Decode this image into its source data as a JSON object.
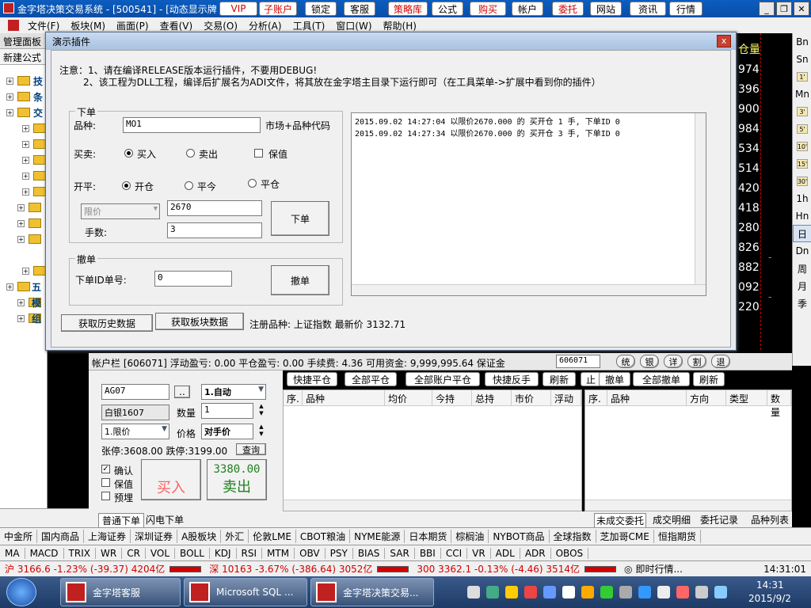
{
  "app": {
    "title": "金字塔决策交易系统 - [500541] - [动态显示牌",
    "top_buttons": [
      "VIP",
      "子账户",
      "锁定",
      "客服",
      "策略库",
      "公式",
      "购买",
      "帐户",
      "委托",
      "网站",
      "资讯",
      "行情"
    ],
    "red_buttons": [
      "VIP",
      "子账户",
      "策略库",
      "购买",
      "委托"
    ]
  },
  "menu": [
    "文件(F)",
    "板块(M)",
    "画面(P)",
    "查看(V)",
    "交易(O)",
    "分析(A)",
    "工具(T)",
    "窗口(W)",
    "帮助(H)"
  ],
  "left_panel": {
    "title": "管理面板",
    "sub": "新建公式",
    "items": [
      "技",
      "条",
      "交",
      "五",
      "模",
      "组"
    ]
  },
  "chart_values": {
    "header": "仓量",
    "values": [
      "974",
      "396",
      "900",
      "984",
      "534",
      "514",
      "420",
      "418",
      "280",
      "826",
      "882",
      "092",
      "220"
    ],
    "markers": [
      "-",
      "-"
    ]
  },
  "right_toolbar": [
    "Bn",
    "Sn",
    "1'",
    "Mn",
    "3'",
    "5'",
    "10'",
    "15'",
    "30'",
    "1h",
    "Hn",
    "日",
    "Dn",
    "周",
    "月",
    "季"
  ],
  "dialog": {
    "title": "演示插件",
    "close": "x",
    "note1": "注意：1、请在编译RELEASE版本运行插件，不要用DEBUG!",
    "note2": "2、该工程为DLL工程，编译后扩展名为ADI文件，将其放在金字塔主目录下运行即可（在工具菜单->扩展中看到你的插件）",
    "order_group": "下单",
    "symbol_label": "品种:",
    "symbol_value": "MO1",
    "symbol_hint": "市场+品种代码",
    "side_label": "买卖:",
    "buy": "买入",
    "sell": "卖出",
    "hedge": "保值",
    "offset_label": "开平:",
    "open": "开仓",
    "close_today": "平今",
    "close_pos": "平仓",
    "price_type": "限价",
    "price_value": "2670",
    "qty_label": "手数:",
    "qty_value": "3",
    "order_button": "下单",
    "cancel_group": "撤单",
    "cancel_id_label": "下单ID单号:",
    "cancel_id_value": "0",
    "cancel_button": "撤单",
    "log": [
      "2015.09.02 14:27:04 以限价2670.000 的 买开仓 1 手, 下单ID 0",
      "2015.09.02 14:27:34 以限价2670.000 的 买开仓 3 手, 下单ID 0"
    ],
    "hist_button": "获取历史数据",
    "block_button": "获取板块数据",
    "reg_text": "注册品种: 上证指数 最新价 3132.71"
  },
  "account_bar": {
    "text": "帐户栏 [606071] 浮动盈亏: 0.00   平仓盈亏: 0.00   手续费: 4.36   可用资金: 9,999,995.64   保证金",
    "account": "606071",
    "right_btns": [
      "统",
      "银",
      "详",
      "割",
      "退"
    ]
  },
  "order_panel": {
    "code": "AG07",
    "dots": "..",
    "mode": "1.自动",
    "name": "白银1607",
    "qty_label": "数量",
    "qty": "1",
    "price_type": "1.限价",
    "price_label": "价格",
    "price": "对手价",
    "limits": "张停:3608.00 跌停:3199.00",
    "query": "查询",
    "confirm": "确认",
    "hedge": "保值",
    "preset": "预埋",
    "buy": "买入",
    "sell_price": "3380.00",
    "sell": "卖出"
  },
  "action_buttons": [
    "快捷平仓",
    "全部平仓",
    "全部账户平仓",
    "快捷反手",
    "刷新",
    "止",
    "撤单",
    "全部撤单",
    "刷新"
  ],
  "mid_table": {
    "headers": [
      "序.",
      "品种",
      "均价",
      "今持",
      "总持",
      "市价",
      "浮动"
    ],
    "footer": "606071"
  },
  "right_table": {
    "headers": [
      "序.",
      "品种",
      "方向",
      "类型",
      "数量"
    ]
  },
  "bottom_tabs_left": [
    "公式",
    "普通下单",
    "闪电下单"
  ],
  "bottom_tabs_right": [
    "未成交委托",
    "成交明细",
    "委托记录",
    "品种列表"
  ],
  "markets": [
    "中金所",
    "国内商品",
    "上海证券",
    "深圳证券",
    "A股板块",
    "外汇",
    "伦敦LME",
    "CBOT粮油",
    "NYME能源",
    "日本期货",
    "棕榈油",
    "NYBOT商品",
    "全球指数",
    "芝加哥CME",
    "恒指期货"
  ],
  "indicators": [
    "MA",
    "MACD",
    "TRIX",
    "WR",
    "CR",
    "VOL",
    "BOLL",
    "KDJ",
    "RSI",
    "MTM",
    "OBV",
    "PSY",
    "BIAS",
    "SAR",
    "BBI",
    "CCI",
    "VR",
    "ADL",
    "ADR",
    "OBOS"
  ],
  "quotes": {
    "sh": "沪 3166.6 -1.23% (-39.37) 4204亿",
    "sz": "深 10163 -3.67% (-386.64) 3052亿",
    "i300": "300 3362.1 -0.13% (-4.46) 3514亿",
    "news": "即时行情...",
    "time": "14:31:01"
  },
  "taskbar": {
    "tasks": [
      "金字塔客服",
      "Microsoft SQL ...",
      "金字塔决策交易..."
    ],
    "clock": "14:31",
    "date": "2015/9/2"
  }
}
